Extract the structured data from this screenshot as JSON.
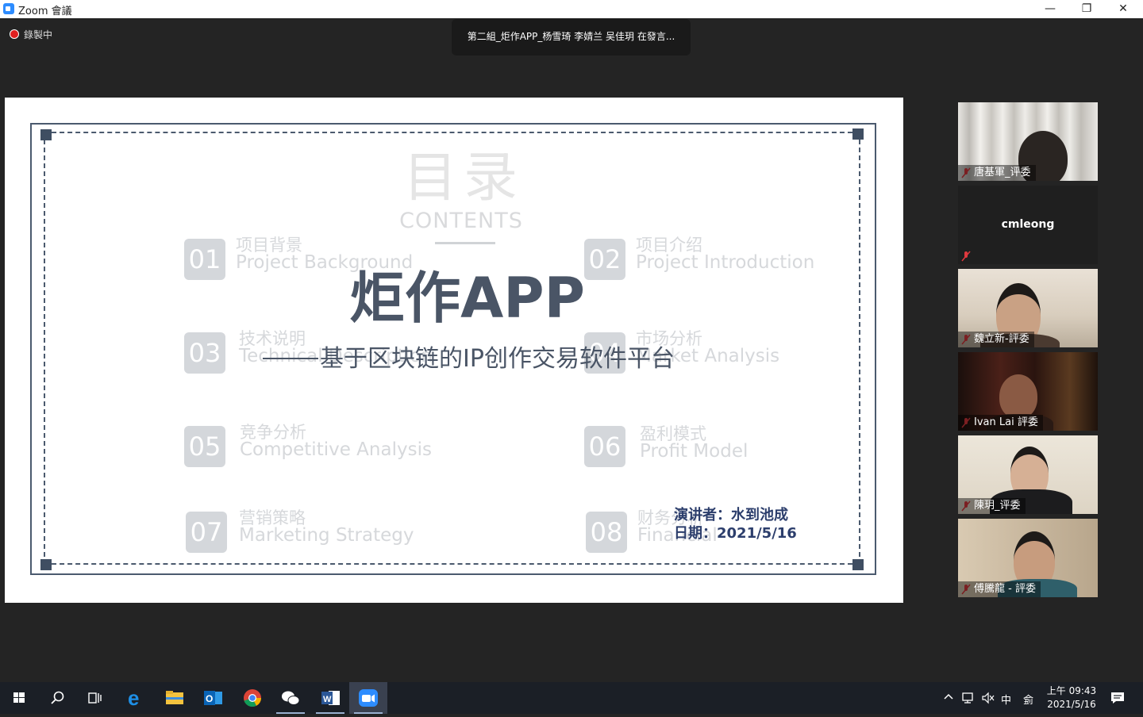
{
  "window": {
    "title": "Zoom 會議",
    "minimize": "—",
    "restore": "❐",
    "close": "✕"
  },
  "recording": {
    "label": "錄製中"
  },
  "speaker_banner": "第二組_炬作APP_杨雪琦 李婧兰 吴佳玥 在發言...",
  "slide": {
    "toc_title": "目录",
    "toc_sub": "CONTENTS",
    "items": [
      {
        "num": "01",
        "zh": "项目背景",
        "en": "Project Background"
      },
      {
        "num": "02",
        "zh": "项目介绍",
        "en": "Project Introduction"
      },
      {
        "num": "03",
        "zh": "技术说明",
        "en": "Technical Description"
      },
      {
        "num": "04",
        "zh": "市场分析",
        "en": "Market Analysis"
      },
      {
        "num": "05",
        "zh": "竞争分析",
        "en": "Competitive Analysis"
      },
      {
        "num": "06",
        "zh": "盈利模式",
        "en": "Profit Model"
      },
      {
        "num": "07",
        "zh": "营销策略",
        "en": "Marketing Strategy"
      },
      {
        "num": "08",
        "zh": "财务分析",
        "en": "Financial"
      }
    ],
    "main_title": "炬作APP",
    "main_subtitle": "基于区块链的IP创作交易软件平台",
    "presenter": "演讲者：水到池成",
    "date": "日期：2021/5/16"
  },
  "participants": [
    {
      "name": "唐基軍_评委"
    },
    {
      "name": "cmleong"
    },
    {
      "name": "魏立新-評委"
    },
    {
      "name": "Ivan Lai 評委"
    },
    {
      "name": "陳玥_评委"
    },
    {
      "name": "傅騰龍 - 評委"
    }
  ],
  "taskbar": {
    "icons": [
      "windows-start-icon",
      "search-icon",
      "task-view-icon",
      "edge-icon",
      "file-explorer-icon",
      "outlook-icon",
      "chrome-icon",
      "wechat-icon",
      "word-icon",
      "zoom-icon"
    ],
    "tray_ime": "中",
    "tray_ime2": "侴",
    "time": "上午 09:43",
    "date": "2021/5/16"
  }
}
